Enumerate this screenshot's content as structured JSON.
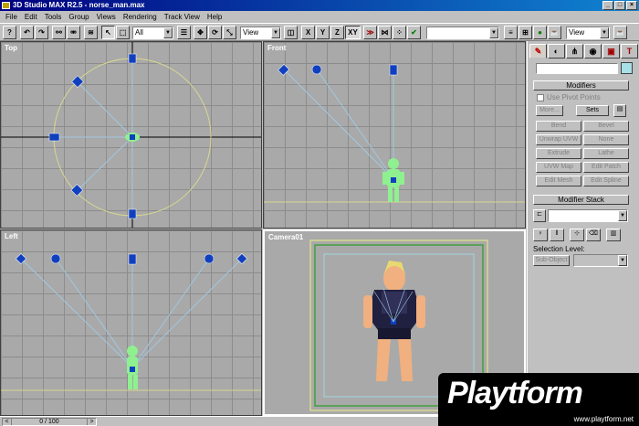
{
  "window": {
    "title": "3D Studio MAX R2.5 - norse_man.max"
  },
  "menu": [
    "File",
    "Edit",
    "Tools",
    "Group",
    "Views",
    "Rendering",
    "Track View",
    "Help"
  ],
  "toolbar": {
    "selection_filter": "All",
    "ref_coord": "View",
    "axis_x": "X",
    "axis_y": "Y",
    "axis_z": "Z",
    "axis_xy": "XY",
    "named_selection": "",
    "render_type": "View"
  },
  "viewports": {
    "top": "Top",
    "front": "Front",
    "left": "Left",
    "camera": "Camera01"
  },
  "command_panel": {
    "modifiers_title": "Modifiers",
    "use_pivot_points": "Use Pivot Points",
    "more": "More...",
    "sets": "Sets",
    "bend": "Bend",
    "bevel": "Bevel",
    "unwrap_uvw": "Unwrap UVW",
    "none": "None",
    "extrude": "Extrude",
    "lathe": "Lathe",
    "uvw_map": "UVW Map",
    "edit_patch": "Edit Patch",
    "edit_mesh": "Edit Mesh",
    "edit_spline": "Edit Spline",
    "modifier_stack_title": "Modifier Stack",
    "selection_level": "Selection Level:",
    "sub_object": "Sub-Object"
  },
  "status": {
    "frame": "0 / 100"
  },
  "watermark": {
    "brand": "Playtform",
    "url": "www.playtform.net"
  },
  "colors": {
    "grid_bg": "#a9a9a9",
    "bone_blue": "#1040c0",
    "character_green": "#8ff08f",
    "title_bar": "#000080"
  }
}
